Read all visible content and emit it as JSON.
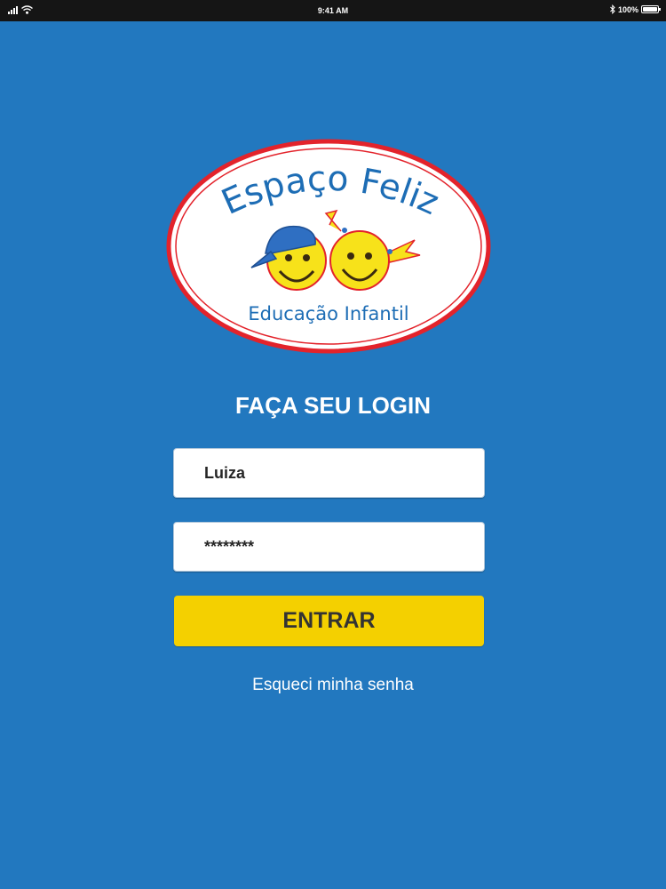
{
  "status_bar": {
    "time": "9:41 AM",
    "battery_text": "100%",
    "battery_level_percent": 100,
    "icons": [
      "signal-icon",
      "wifi-icon",
      "bluetooth-icon",
      "battery-icon"
    ]
  },
  "logo": {
    "title": "Espaço Feliz",
    "subtitle": "Educação Infantil"
  },
  "login": {
    "heading": "FAÇA SEU LOGIN",
    "username_value": "Luiza",
    "password_value": "********",
    "enter_label": "ENTRAR",
    "forgot_label": "Esqueci minha senha"
  },
  "colors": {
    "background": "#2278bf",
    "status_bar": "#151515",
    "button": "#f4d000",
    "button_text": "#333333",
    "logo_border": "#e3232b",
    "logo_text": "#1d6db5",
    "face": "#f7e21a"
  }
}
